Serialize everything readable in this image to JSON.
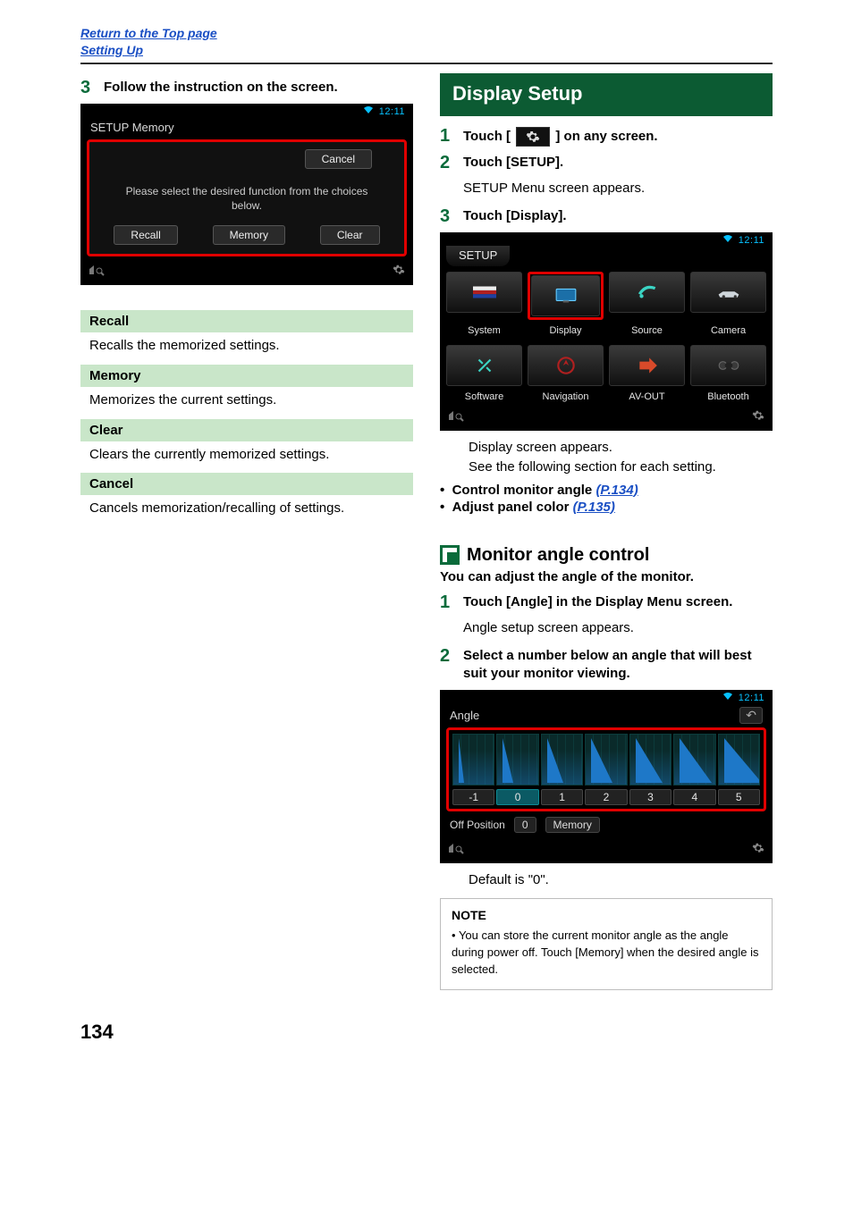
{
  "header": {
    "return_link": "Return to the Top page",
    "section_link": "Setting Up"
  },
  "left": {
    "step3": {
      "num": "3",
      "text": "Follow the instruction on the screen."
    },
    "shot1": {
      "time": "12:11",
      "title": "SETUP Memory",
      "cancel": "Cancel",
      "msg1": "Please select the desired function from the choices",
      "msg2": "below.",
      "btn_recall": "Recall",
      "btn_memory": "Memory",
      "btn_clear": "Clear"
    },
    "defs": {
      "recall_h": "Recall",
      "recall_b": "Recalls the memorized settings.",
      "memory_h": "Memory",
      "memory_b": "Memorizes the current settings.",
      "clear_h": "Clear",
      "clear_b": "Clears the currently memorized settings.",
      "cancel_h": "Cancel",
      "cancel_b": "Cancels memorization/recalling of settings."
    }
  },
  "right": {
    "banner": "Display Setup",
    "step1": {
      "num": "1",
      "pre": "Touch [",
      "post": "] on any screen."
    },
    "step2": {
      "num": "2",
      "text": "Touch [SETUP].",
      "sub": "SETUP Menu screen appears."
    },
    "step3": {
      "num": "3",
      "text": "Touch [Display]."
    },
    "shot2": {
      "time": "12:11",
      "title": "SETUP",
      "row1": [
        "System",
        "Display",
        "Source",
        "Camera"
      ],
      "row2": [
        "Software",
        "Navigation",
        "AV-OUT",
        "Bluetooth"
      ]
    },
    "after_shot2_l1": "Display screen appears.",
    "after_shot2_l2": "See the following section for each setting.",
    "bullets": [
      {
        "label": "Control monitor angle",
        "ref": "(P.134)"
      },
      {
        "label": "Adjust panel color",
        "ref": "(P.135)"
      }
    ],
    "sub_heading": "Monitor angle control",
    "sub_intro": "You can adjust the angle of the monitor.",
    "mstep1": {
      "num": "1",
      "text": "Touch [Angle] in the Display Menu screen.",
      "sub": "Angle setup screen appears."
    },
    "mstep2": {
      "num": "2",
      "text": "Select a number below an angle that will best suit your monitor viewing."
    },
    "shot3": {
      "time": "12:11",
      "title": "Angle",
      "nums": [
        "-1",
        "0",
        "1",
        "2",
        "3",
        "4",
        "5"
      ],
      "selected_index": 1,
      "off_label": "Off Position",
      "off_val": "0",
      "memory_btn": "Memory"
    },
    "default_line": "Default is \"0\".",
    "note_head": "NOTE",
    "note_body": "You can store the current monitor angle as the angle during power off. Touch [Memory] when the desired angle is selected."
  },
  "page_number": "134"
}
